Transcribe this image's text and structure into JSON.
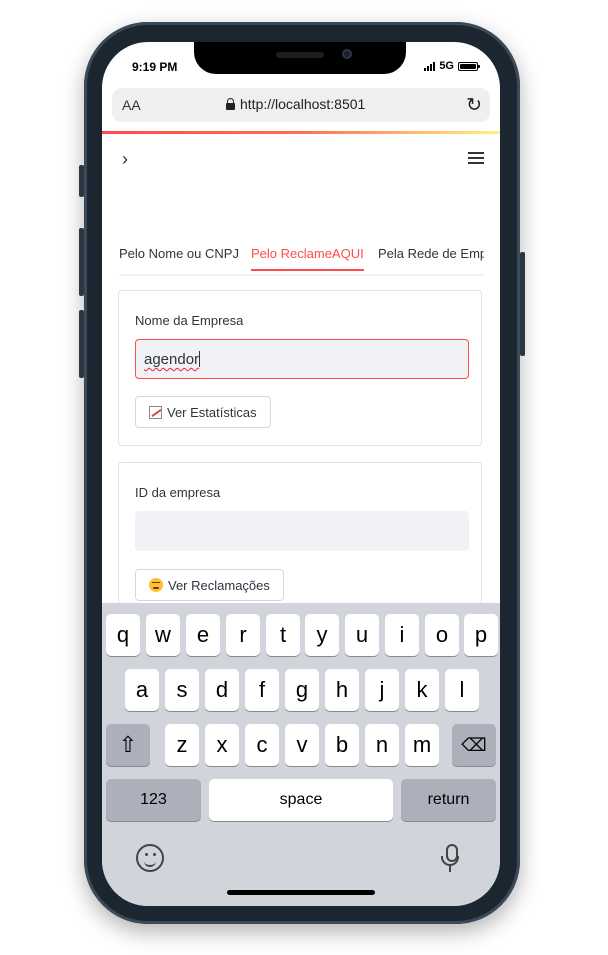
{
  "status": {
    "time": "9:19 PM",
    "network": "5G"
  },
  "browser": {
    "text_size": "AA",
    "url": "http://localhost:8501"
  },
  "tabs": [
    {
      "label": "Pelo Nome ou CNPJ"
    },
    {
      "label": "Pelo ReclameAQUI",
      "active": true
    },
    {
      "label": "Pela Rede de Empresas"
    }
  ],
  "form1": {
    "label": "Nome da Empresa",
    "value": "agendor",
    "button": "Ver Estatísticas"
  },
  "form2": {
    "label": "ID da empresa",
    "value": "",
    "button": "Ver Reclamações"
  },
  "keyboard": {
    "row1": [
      "q",
      "w",
      "e",
      "r",
      "t",
      "y",
      "u",
      "i",
      "o",
      "p"
    ],
    "row2": [
      "a",
      "s",
      "d",
      "f",
      "g",
      "h",
      "j",
      "k",
      "l"
    ],
    "row3": [
      "z",
      "x",
      "c",
      "v",
      "b",
      "n",
      "m"
    ],
    "numbers": "123",
    "space": "space",
    "return": "return"
  },
  "colors": {
    "accent": "#ff4b4b",
    "input_bg": "#f0f2f6",
    "keyboard_bg": "#d1d4db"
  }
}
